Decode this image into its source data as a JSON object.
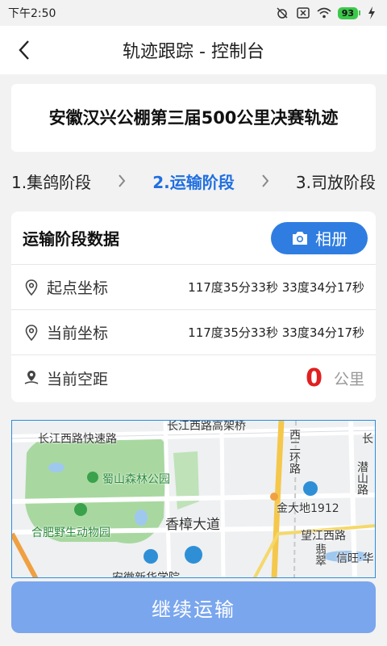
{
  "status": {
    "time": "下午2:50",
    "battery": "93"
  },
  "header": {
    "title": "轨迹跟踪 - 控制台"
  },
  "race": {
    "title": "安徽汉兴公棚第三届500公里决赛轨迹"
  },
  "steps": [
    {
      "label": "1.集鸽阶段",
      "active": false
    },
    {
      "label": "2.运输阶段",
      "active": true
    },
    {
      "label": "3.司放阶段",
      "active": false
    }
  ],
  "data_card": {
    "heading": "运输阶段数据",
    "album_label": "相册",
    "start": {
      "label": "起点坐标",
      "value": "117度35分33秒 33度34分17秒"
    },
    "current": {
      "label": "当前坐标",
      "value": "117度35分33秒 33度34分17秒"
    },
    "distance": {
      "label": "当前空距",
      "value": "0",
      "unit": "公里"
    }
  },
  "map": {
    "labels": {
      "road1": "长江西路高架桥",
      "road2": "长江西路快速路",
      "park": "蜀山森林公园",
      "zoo": "合肥野生动物园",
      "avenue": "香樟大道",
      "ring": "西二环路",
      "landmark": "金大地1912",
      "road3": "望江西路",
      "road4": "潜山路",
      "school": "安徽新华学院",
      "place": "信旺·华",
      "edge": "长",
      "fei": "翡翠"
    }
  },
  "action": {
    "continue_label": "继续运输"
  },
  "colors": {
    "primary": "#2f7de1",
    "active_step": "#1f6fe0",
    "distance": "#e02020",
    "button_disabled": "#7aa6ee"
  }
}
